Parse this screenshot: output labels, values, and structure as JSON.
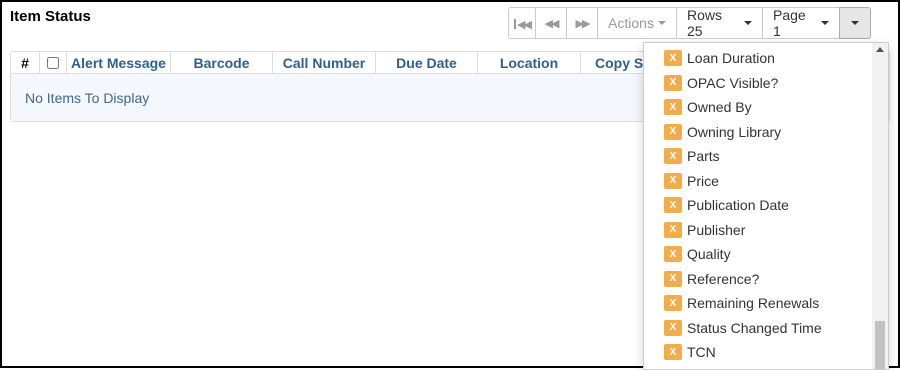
{
  "panel": {
    "title": "Item Status"
  },
  "toolbar": {
    "first_icon": "first-page-icon",
    "prev_icon": "previous-page-icon",
    "next_icon": "next-page-icon",
    "actions_label": "Actions",
    "rows_label": "Rows 25",
    "page_label": "Page 1",
    "columns_icon": "caret-down-icon"
  },
  "grid": {
    "columns": [
      "#",
      "",
      "Alert Message",
      "Barcode",
      "Call Number",
      "Due Date",
      "Location",
      "Copy Sta"
    ],
    "empty_message": "No Items To Display"
  },
  "column_menu": {
    "badge": "X",
    "items": [
      "Loan Duration",
      "OPAC Visible?",
      "Owned By",
      "Owning Library",
      "Parts",
      "Price",
      "Publication Date",
      "Publisher",
      "Quality",
      "Reference?",
      "Remaining Renewals",
      "Status Changed Time",
      "TCN"
    ]
  },
  "colors": {
    "badge": "#f0ad4e",
    "header_text": "#2f5f8f",
    "empty_bg": "#f4f7fb"
  }
}
